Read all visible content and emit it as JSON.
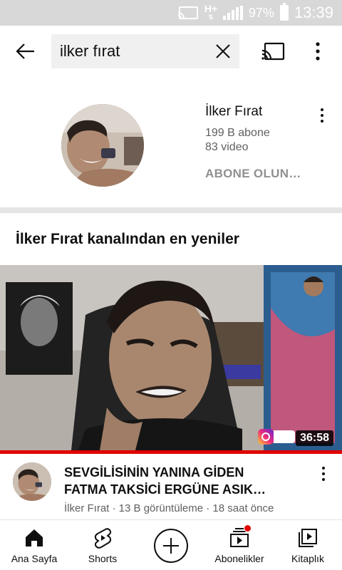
{
  "status_bar": {
    "network": "H+",
    "battery": "97%",
    "time": "13:39",
    "icons": [
      "cast-icon",
      "network-type-icon",
      "signal-icon",
      "battery-icon"
    ]
  },
  "search": {
    "query": "ilker fırat",
    "icons": [
      "back-arrow-icon",
      "clear-icon",
      "cast-icon",
      "more-vert-icon"
    ]
  },
  "channel": {
    "name": "İlker Fırat",
    "subscribers": "199 B abone",
    "videos": "83 video",
    "subscribe_label": "ABONE OLUN…"
  },
  "section": {
    "title": "İlker Fırat kanalından en yeniler"
  },
  "video": {
    "duration": "36:58",
    "progress": 1.0,
    "progress_color": "#e00000",
    "title_line1": "SEVGİLİSİNİN YANINA GİDEN",
    "title_line2": "FATMA TAKSİCİ ERGÜNE ASIK…",
    "meta": "İlker Fırat · 13 B görüntüleme · 18 saat önce"
  },
  "bottom_nav": {
    "items": [
      {
        "label": "Ana Sayfa",
        "icon": "home-icon"
      },
      {
        "label": "Shorts",
        "icon": "shorts-icon"
      },
      {
        "label": "",
        "icon": "create-plus-icon"
      },
      {
        "label": "Abonelikler",
        "icon": "subscriptions-icon"
      },
      {
        "label": "Kitaplık",
        "icon": "library-icon"
      }
    ]
  },
  "colors": {
    "accent_red": "#e00000",
    "status_bar_bg": "#d8d8d8",
    "secondary_text": "#606060"
  }
}
